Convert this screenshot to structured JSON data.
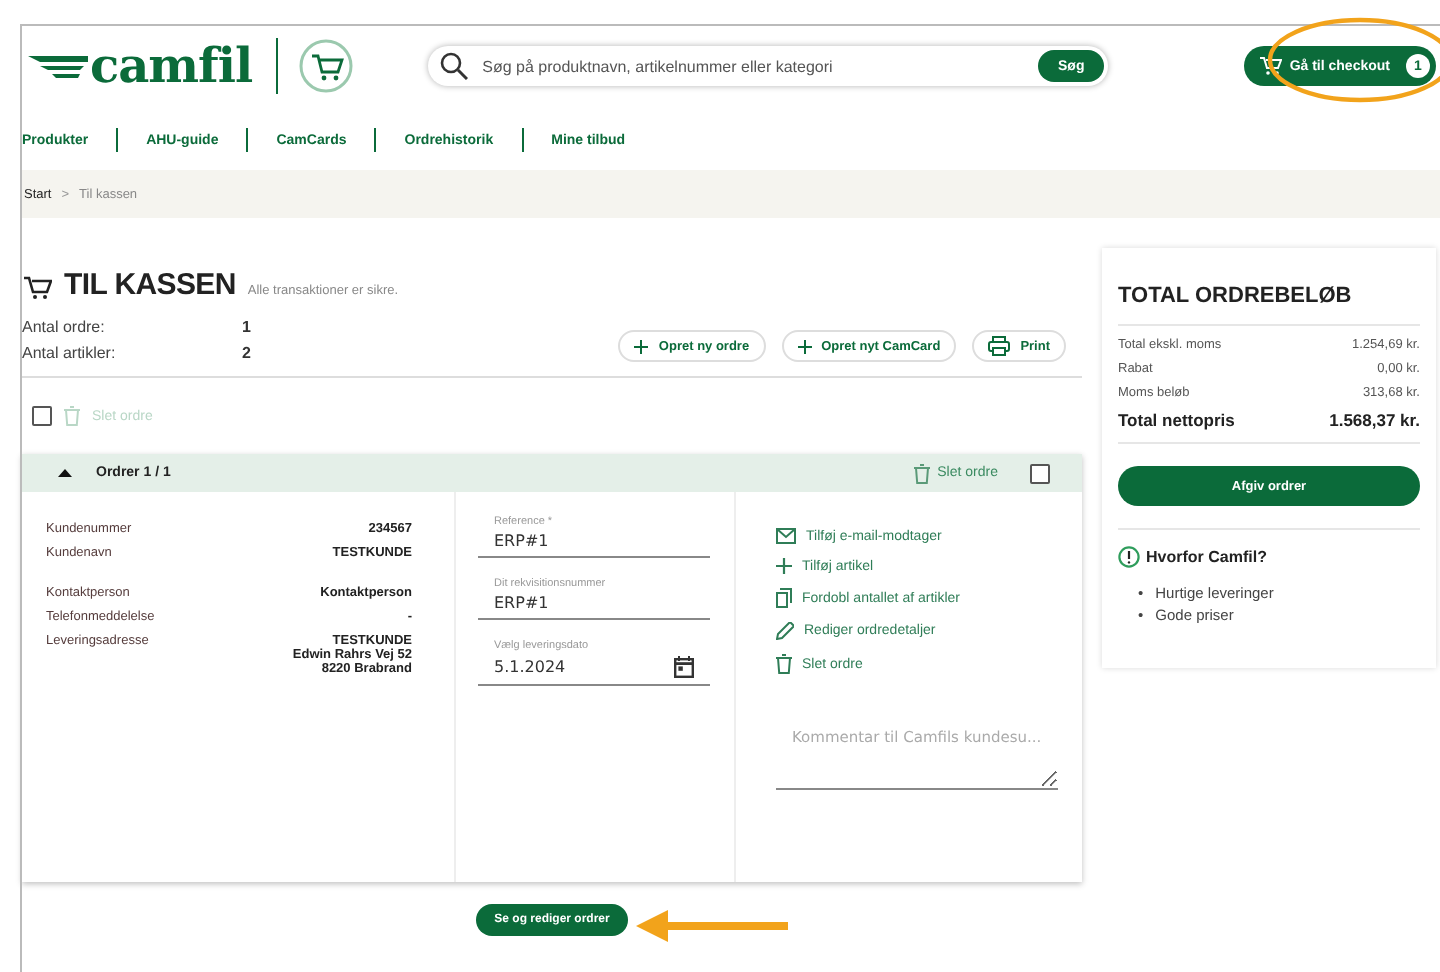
{
  "header": {
    "logo": "camfil",
    "search": {
      "placeholder": "Søg på produktnavn, artikelnummer eller kategori",
      "button": "Søg"
    },
    "checkout": {
      "label": "Gå til checkout",
      "count": "1"
    }
  },
  "nav": [
    "Produkter",
    "AHU-guide",
    "CamCards",
    "Ordrehistorik",
    "Mine tilbud"
  ],
  "breadcrumb": {
    "items": [
      "Start",
      "Til kassen"
    ],
    "separator": ">"
  },
  "checkout": {
    "title": "TIL KASSEN",
    "subtitle": "Alle transaktioner er sikre.",
    "stats": [
      {
        "label": "Antal ordre:",
        "value": "1"
      },
      {
        "label": "Antal artikler:",
        "value": "2"
      }
    ],
    "actions": [
      {
        "kind": "plus",
        "label": "Opret ny ordre"
      },
      {
        "kind": "plus",
        "label": "Opret nyt CamCard"
      },
      {
        "kind": "print",
        "label": "Print"
      }
    ],
    "bulk": {
      "checked": false,
      "delete": "Slet ordre"
    },
    "order": {
      "title": "Ordrer 1 / 1",
      "expanded": true,
      "delete": "Slet ordre",
      "checked": false,
      "details": [
        {
          "label": "Kundenummer",
          "value": [
            "234567"
          ]
        },
        {
          "label": "Kundenavn",
          "value": [
            "TESTKUNDE"
          ]
        },
        {
          "label": "Kontaktperson",
          "value": [
            "Kontaktperson"
          ]
        },
        {
          "label": "Telefonmeddelelse",
          "value": [
            "-"
          ]
        },
        {
          "label": "Leveringsadresse",
          "value": [
            "TESTKUNDE",
            "Edwin Rahrs Vej 52",
            "8220 Brabrand"
          ]
        }
      ],
      "fields": [
        {
          "kind": "text",
          "label": "Reference *",
          "value": "ERP#1"
        },
        {
          "kind": "text",
          "label": "Dit rekvisitionsnummer",
          "value": "ERP#1"
        },
        {
          "kind": "date",
          "label": "Vælg leveringsdato",
          "value": "5.1.2024"
        }
      ],
      "links": [
        {
          "kind": "mail",
          "label": "Tilføj e-mail-modtager"
        },
        {
          "kind": "plus",
          "label": "Tilføj artikel"
        },
        {
          "kind": "copy",
          "label": "Fordobl antallet af artikler"
        },
        {
          "kind": "pencil",
          "label": "Rediger ordredetaljer"
        },
        {
          "kind": "trash",
          "label": "Slet ordre"
        }
      ],
      "comment": {
        "placeholder": "Kommentar til Camfils kundesu..."
      }
    },
    "view_button": "Se og rediger ordrer"
  },
  "summary": {
    "title": "TOTAL ORDREBELØB",
    "rows": [
      {
        "label": "Total ekskl. moms",
        "value": "1.254,69 kr."
      },
      {
        "label": "Rabat",
        "value": "0,00 kr."
      },
      {
        "label": "Moms beløb",
        "value": "313,68 kr."
      }
    ],
    "total": {
      "label": "Total nettopris",
      "value": "1.568,37 kr."
    },
    "button": "Afgiv ordrer",
    "why": {
      "title": "Hvorfor Camfil?",
      "bullet": "•",
      "items": [
        "Hurtige leveringer",
        "Gode priser"
      ]
    }
  }
}
